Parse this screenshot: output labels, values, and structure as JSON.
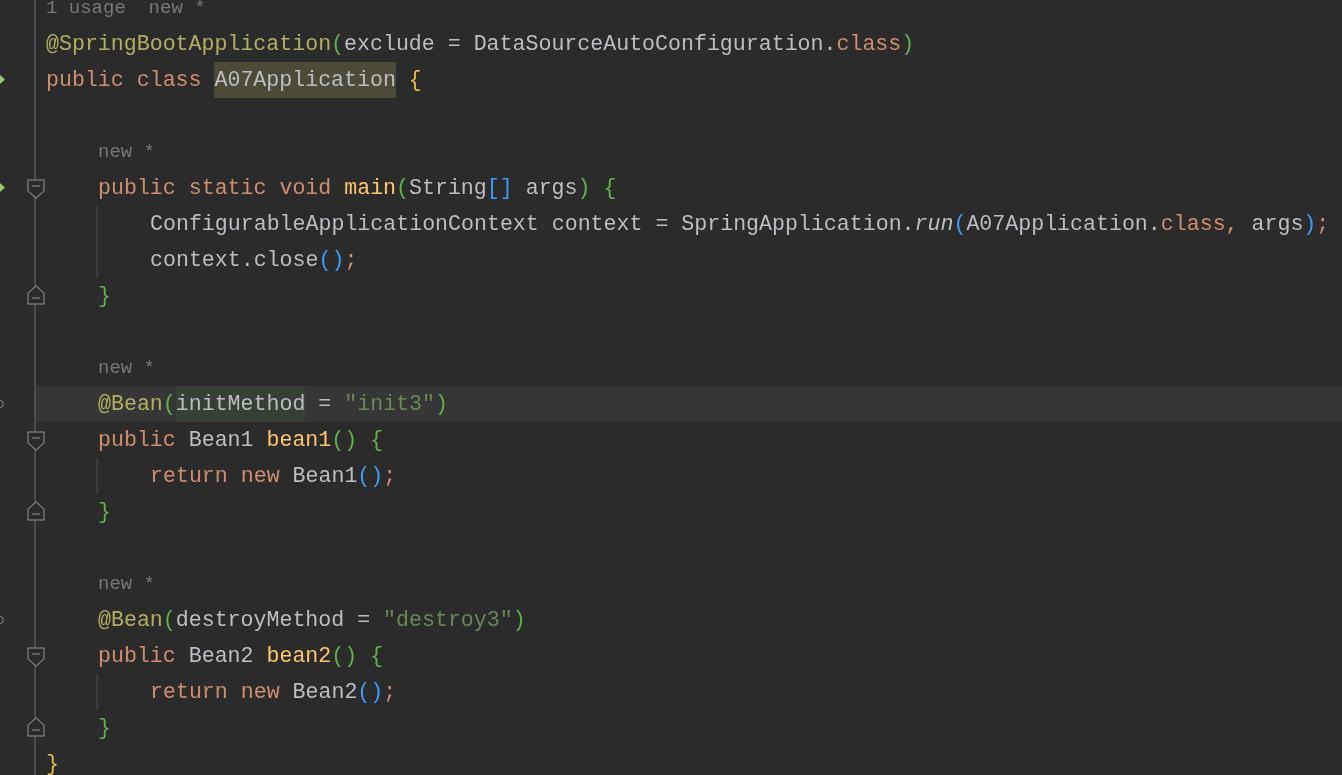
{
  "lines": [
    {
      "kind": "hint",
      "tokens": [
        {
          "text": "1 usage  new *",
          "kind": "hint"
        }
      ]
    },
    {
      "kind": "code",
      "tokens": [
        {
          "text": "@SpringBootApplication",
          "kind": "ann"
        },
        {
          "text": "(",
          "kind": "p1"
        },
        {
          "text": "exclude = DataSourceAutoConfiguration.",
          "kind": "plain"
        },
        {
          "text": "class",
          "kind": "kw"
        },
        {
          "text": ")",
          "kind": "p1"
        }
      ]
    },
    {
      "kind": "code",
      "run_marker": true,
      "tokens": [
        {
          "text": "public class ",
          "kind": "kw"
        },
        {
          "text": "A07Application",
          "kind": "plain",
          "usage_highlight": true
        },
        {
          "text": " {",
          "kind": "brace"
        }
      ],
      "children": [
        {
          "kind": "blank"
        },
        {
          "kind": "hint",
          "tokens": [
            {
              "text": "new *",
              "kind": "hint"
            }
          ]
        },
        {
          "kind": "code",
          "run_marker": true,
          "fold_start": true,
          "tokens": [
            {
              "text": "public static void ",
              "kind": "kw"
            },
            {
              "text": "main",
              "kind": "fn"
            },
            {
              "text": "(",
              "kind": "p1"
            },
            {
              "text": "String",
              "kind": "plain"
            },
            {
              "text": "[]",
              "kind": "p2"
            },
            {
              "text": " args",
              "kind": "plain"
            },
            {
              "text": ") {",
              "kind": "p1"
            }
          ],
          "children": [
            {
              "kind": "code",
              "guide": true,
              "tokens": [
                {
                  "text": "ConfigurableApplicationContext context = SpringApplication.",
                  "kind": "plain"
                },
                {
                  "text": "run",
                  "kind": "call"
                },
                {
                  "text": "(",
                  "kind": "p2"
                },
                {
                  "text": "A07Application.",
                  "kind": "plain"
                },
                {
                  "text": "class,",
                  "kind": "kw"
                },
                {
                  "text": " args",
                  "kind": "plain"
                },
                {
                  "text": ")",
                  "kind": "p2"
                },
                {
                  "text": ";",
                  "kind": "kw"
                }
              ]
            },
            {
              "kind": "code",
              "guide": true,
              "tokens": [
                {
                  "text": "context.close",
                  "kind": "plain"
                },
                {
                  "text": "()",
                  "kind": "p2"
                },
                {
                  "text": ";",
                  "kind": "kw"
                }
              ]
            }
          ]
        },
        {
          "kind": "code",
          "fold_end": true,
          "tokens": [
            {
              "text": "}",
              "kind": "p1"
            }
          ]
        },
        {
          "kind": "blank"
        },
        {
          "kind": "hint",
          "tokens": [
            {
              "text": "new *",
              "kind": "hint"
            }
          ]
        },
        {
          "kind": "code",
          "current": true,
          "bean_marker": true,
          "tokens": [
            {
              "text": "@Bean",
              "kind": "ann"
            },
            {
              "text": "(",
              "kind": "p1"
            },
            {
              "text": "initMethod",
              "kind": "plain",
              "param_highlight": true
            },
            {
              "text": " = ",
              "kind": "plain"
            },
            {
              "text": "\"init3\"",
              "kind": "str"
            },
            {
              "text": ")",
              "kind": "p1"
            }
          ]
        },
        {
          "kind": "code",
          "fold_start": true,
          "tokens": [
            {
              "text": "public ",
              "kind": "kw"
            },
            {
              "text": "Bean1 ",
              "kind": "plain"
            },
            {
              "text": "bean1",
              "kind": "fn"
            },
            {
              "text": "() {",
              "kind": "p1"
            }
          ],
          "children": [
            {
              "kind": "code",
              "guide": true,
              "tokens": [
                {
                  "text": "return new ",
                  "kind": "kw"
                },
                {
                  "text": "Bean1",
                  "kind": "plain"
                },
                {
                  "text": "()",
                  "kind": "p2"
                },
                {
                  "text": ";",
                  "kind": "kw"
                }
              ]
            }
          ]
        },
        {
          "kind": "code",
          "fold_end": true,
          "tokens": [
            {
              "text": "}",
              "kind": "p1"
            }
          ]
        },
        {
          "kind": "blank"
        },
        {
          "kind": "hint",
          "tokens": [
            {
              "text": "new *",
              "kind": "hint"
            }
          ]
        },
        {
          "kind": "code",
          "bean_marker": true,
          "tokens": [
            {
              "text": "@Bean",
              "kind": "ann"
            },
            {
              "text": "(",
              "kind": "p1"
            },
            {
              "text": "destroyMethod = ",
              "kind": "plain"
            },
            {
              "text": "\"destroy3\"",
              "kind": "str"
            },
            {
              "text": ")",
              "kind": "p1"
            }
          ]
        },
        {
          "kind": "code",
          "fold_start": true,
          "tokens": [
            {
              "text": "public ",
              "kind": "kw"
            },
            {
              "text": "Bean2 ",
              "kind": "plain"
            },
            {
              "text": "bean2",
              "kind": "fn"
            },
            {
              "text": "() {",
              "kind": "p1"
            }
          ],
          "children": [
            {
              "kind": "code",
              "guide": true,
              "tokens": [
                {
                  "text": "return new ",
                  "kind": "kw"
                },
                {
                  "text": "Bean2",
                  "kind": "plain"
                },
                {
                  "text": "()",
                  "kind": "p2"
                },
                {
                  "text": ";",
                  "kind": "kw"
                }
              ]
            }
          ]
        },
        {
          "kind": "code",
          "fold_end": true,
          "tokens": [
            {
              "text": "}",
              "kind": "p1"
            }
          ]
        }
      ]
    },
    {
      "kind": "code",
      "tokens": [
        {
          "text": "}",
          "kind": "brace"
        }
      ]
    }
  ]
}
